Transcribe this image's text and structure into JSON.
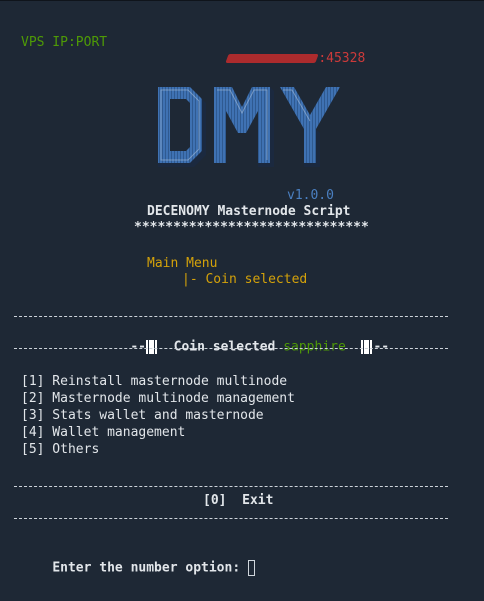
{
  "header": {
    "vps_label": "VPS IP:PORT",
    "port_suffix": ":45328"
  },
  "logo": {
    "letters": "DMY",
    "version": "v1.0.0",
    "script_title": "DECENOMY Masternode Script",
    "stars": "******************************"
  },
  "menu": {
    "title": "Main Menu",
    "sub": "|- Coin selected"
  },
  "coin_banner": {
    "prefix": "--",
    "label": "Coin selected",
    "coin": "sapphire",
    "suffix": "--"
  },
  "options": [
    "[1] Reinstall masternode multinode",
    "[2] Masternode multinode management",
    "[3] Stats wallet and masternode",
    "[4] Wallet management",
    "[5] Others"
  ],
  "exit_option": "[0]  Exit",
  "prompt": "Enter the number option: ",
  "colors": {
    "background": "#1e2835",
    "green": "#4e9a06",
    "red": "#cc3a3a",
    "yellow": "#d4a20a",
    "blue": "#4a7fc0"
  }
}
